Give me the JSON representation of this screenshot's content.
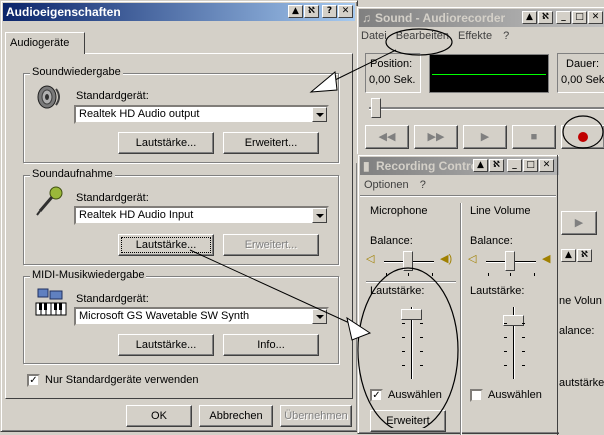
{
  "audio_props": {
    "title": "Audioeigenschaften",
    "tab_label": "Audiogeräte",
    "playback": {
      "group": "Soundwiedergabe",
      "device_label": "Standardgerät:",
      "device": "Realtek HD Audio output",
      "volume_btn": "Lautstärke...",
      "advanced_btn": "Erweitert..."
    },
    "recording": {
      "group": "Soundaufnahme",
      "device_label": "Standardgerät:",
      "device": "Realtek HD Audio Input",
      "volume_btn": "Lautstärke...",
      "advanced_btn": "Erweitert..."
    },
    "midi": {
      "group": "MIDI-Musikwiedergabe",
      "device_label": "Standardgerät:",
      "device": "Microsoft GS Wavetable SW Synth",
      "volume_btn": "Lautstärke...",
      "info_btn": "Info..."
    },
    "default_only_label": "Nur Standardgeräte verwenden",
    "default_only_checked": true,
    "ok": "OK",
    "cancel": "Abbrechen",
    "apply": "Übernehmen"
  },
  "recorder": {
    "title": "Sound - Audiorecorder",
    "menu": [
      "Datei",
      "Bearbeiten",
      "Effekte",
      "?"
    ],
    "position_label": "Position:",
    "position_value": "0,00 Sek.",
    "length_label": "Dauer:",
    "length_value": "0,00 Sek."
  },
  "recording_control": {
    "title": "Recording Control",
    "menu": [
      "Optionen",
      "?"
    ],
    "col1": {
      "name": "Microphone",
      "balance": "Balance:",
      "volume": "Lautstärke:",
      "select": "Auswählen",
      "select_checked": true
    },
    "col2": {
      "name": "Line Volume",
      "balance": "Balance:",
      "volume": "Lautstärke:",
      "select": "Auswählen",
      "select_checked": false
    },
    "advanced_btn": "Erweitert",
    "partial_col_name": "ne Volun",
    "partial_balance": "alance:",
    "partial_volume": "autstärke"
  },
  "colors": {
    "title_active": "#0a246a",
    "title_inactive": "#808080",
    "record": "#c00000",
    "wave_bg": "#000000",
    "wave_line": "#00ff00"
  }
}
